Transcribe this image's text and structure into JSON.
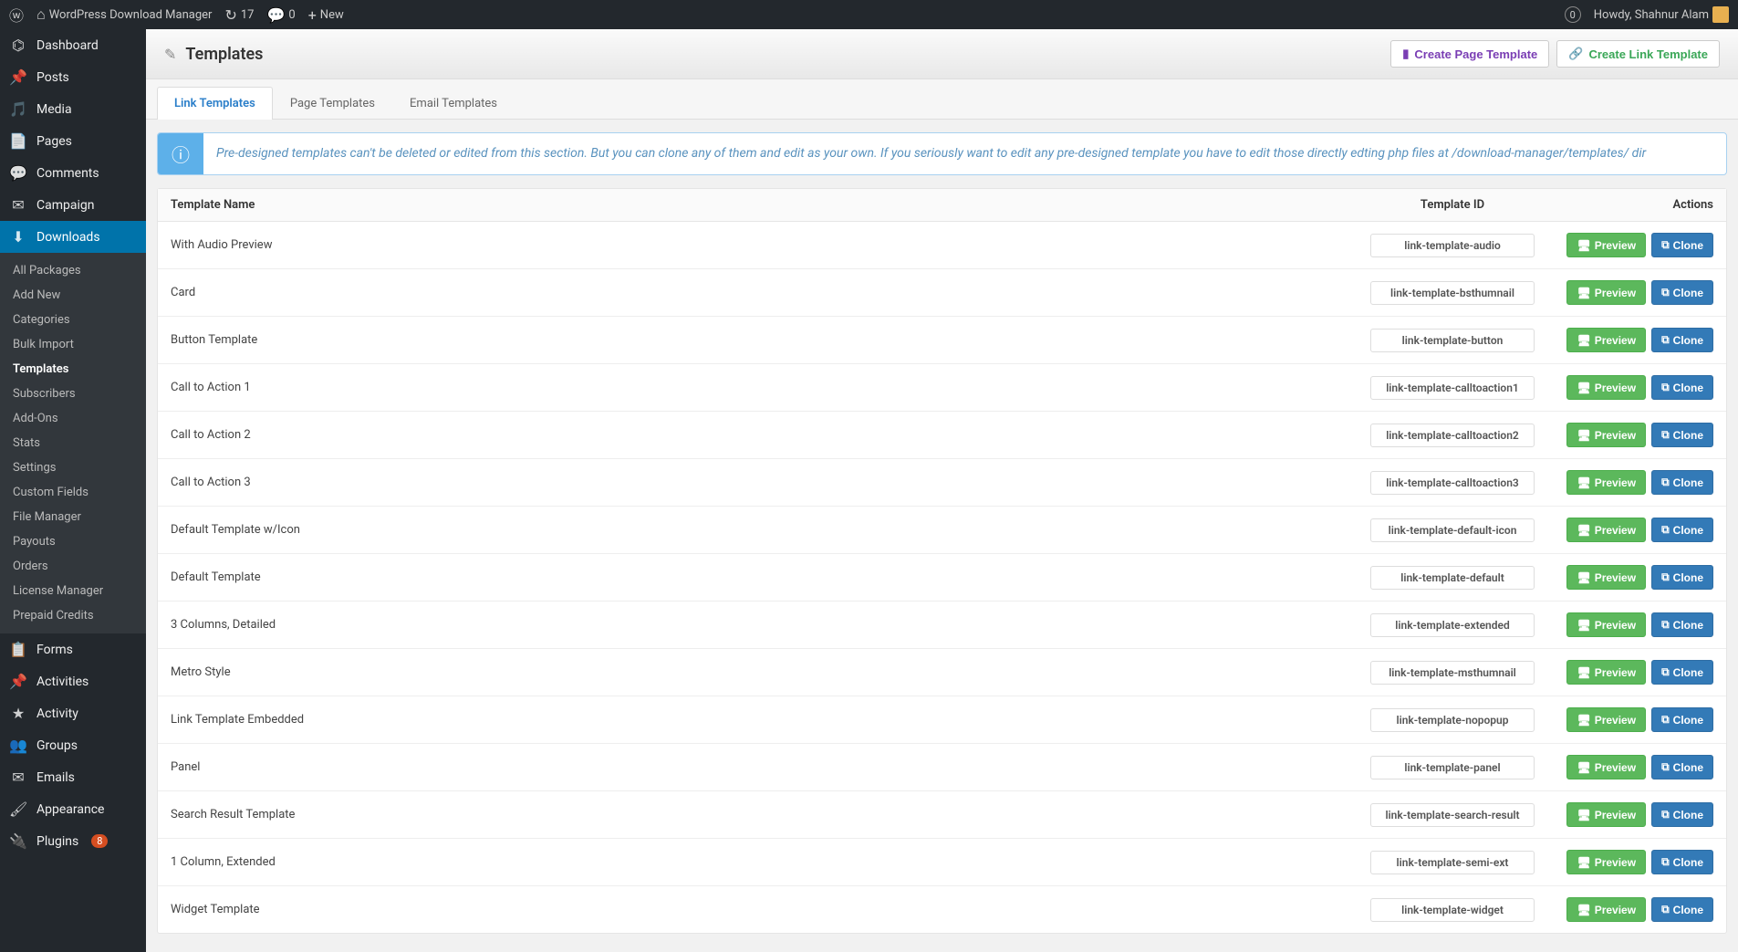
{
  "topbar": {
    "site_name": "WordPress Download Manager",
    "refresh_count": "17",
    "comment_count": "0",
    "new_label": "New",
    "howdy": "Howdy, Shahnur Alam",
    "notif_count": "0"
  },
  "sidebar": {
    "items": [
      {
        "icon": "⌬",
        "label": "Dashboard"
      },
      {
        "icon": "📌",
        "label": "Posts"
      },
      {
        "icon": "🎵",
        "label": "Media"
      },
      {
        "icon": "📄",
        "label": "Pages"
      },
      {
        "icon": "💬",
        "label": "Comments"
      },
      {
        "icon": "✉",
        "label": "Campaign"
      },
      {
        "icon": "⬇",
        "label": "Downloads",
        "active": true
      },
      {
        "icon": "📋",
        "label": "Forms"
      },
      {
        "icon": "📌",
        "label": "Activities"
      },
      {
        "icon": "★",
        "label": "Activity"
      },
      {
        "icon": "👥",
        "label": "Groups"
      },
      {
        "icon": "✉",
        "label": "Emails"
      },
      {
        "icon": "🖌",
        "label": "Appearance"
      },
      {
        "icon": "🔌",
        "label": "Plugins",
        "badge": "8"
      }
    ],
    "submenu": [
      {
        "label": "All Packages"
      },
      {
        "label": "Add New"
      },
      {
        "label": "Categories"
      },
      {
        "label": "Bulk Import"
      },
      {
        "label": "Templates",
        "current": true
      },
      {
        "label": "Subscribers"
      },
      {
        "label": "Add-Ons"
      },
      {
        "label": "Stats"
      },
      {
        "label": "Settings"
      },
      {
        "label": "Custom Fields"
      },
      {
        "label": "File Manager"
      },
      {
        "label": "Payouts"
      },
      {
        "label": "Orders"
      },
      {
        "label": "License Manager"
      },
      {
        "label": "Prepaid Credits"
      }
    ]
  },
  "header": {
    "title": "Templates",
    "btn_page": "Create Page Template",
    "btn_link": "Create Link Template"
  },
  "tabs": [
    {
      "label": "Link Templates",
      "active": true
    },
    {
      "label": "Page Templates"
    },
    {
      "label": "Email Templates"
    }
  ],
  "info": "Pre-designed templates can't be deleted or edited from this section. But you can clone any of them and edit as your own. If you seriously want to edit any pre-designed template you have to edit those directly edting php files at /download-manager/templates/ dir",
  "columns": {
    "name": "Template Name",
    "id": "Template ID",
    "actions": "Actions"
  },
  "actions": {
    "preview": "Preview",
    "clone": "Clone"
  },
  "rows": [
    {
      "name": "With Audio Preview",
      "id": "link-template-audio"
    },
    {
      "name": "Card",
      "id": "link-template-bsthumnail"
    },
    {
      "name": "Button Template",
      "id": "link-template-button"
    },
    {
      "name": "Call to Action 1",
      "id": "link-template-calltoaction1"
    },
    {
      "name": "Call to Action 2",
      "id": "link-template-calltoaction2"
    },
    {
      "name": "Call to Action 3",
      "id": "link-template-calltoaction3"
    },
    {
      "name": "Default Template w/Icon",
      "id": "link-template-default-icon"
    },
    {
      "name": "Default Template",
      "id": "link-template-default"
    },
    {
      "name": "3 Columns, Detailed",
      "id": "link-template-extended"
    },
    {
      "name": "Metro Style",
      "id": "link-template-msthumnail"
    },
    {
      "name": "Link Template Embedded",
      "id": "link-template-nopopup"
    },
    {
      "name": "Panel",
      "id": "link-template-panel"
    },
    {
      "name": "Search Result Template",
      "id": "link-template-search-result"
    },
    {
      "name": "1 Column, Extended",
      "id": "link-template-semi-ext"
    },
    {
      "name": "Widget Template",
      "id": "link-template-widget"
    }
  ]
}
